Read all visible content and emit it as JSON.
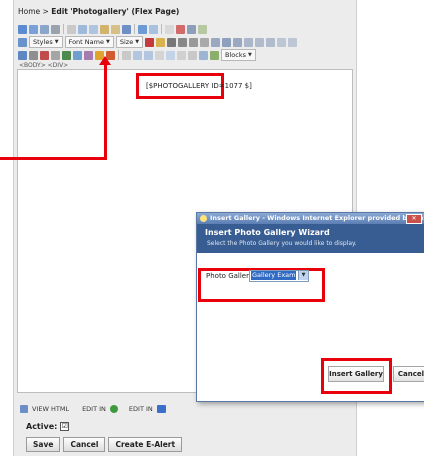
{
  "breadcrumb": {
    "home": "Home",
    "separator": " > ",
    "action": "Edit",
    "page": "'Photogallery' (Flex Page)"
  },
  "toolbar": {
    "styles_label": "Styles",
    "font_name_label": "Font Name",
    "size_label": "Size",
    "blocks_label": "Blocks",
    "row1_icons": [
      "source-icon",
      "preview-icon",
      "templates-icon",
      "print-icon",
      "spellcheck-icon",
      "cut-icon",
      "copy-icon",
      "paste-icon",
      "paste-text-icon",
      "paste-word-icon",
      "undo-icon",
      "redo-icon",
      "find-icon",
      "replace-icon",
      "select-all-icon"
    ],
    "row3_icons": [
      "image-icon",
      "flash-icon",
      "table-icon",
      "horizontal-rule-icon",
      "smiley-icon",
      "special-char-icon",
      "page-break-icon",
      "photogallery-icon",
      "media-icon",
      "form-icon",
      "checkbox-icon",
      "radio-icon",
      "textfield-icon",
      "textarea-icon",
      "select-icon",
      "button-icon",
      "imagebutton-icon",
      "hiddenfield-icon"
    ]
  },
  "tag_path": "<BODY> <DIV>",
  "code_snippet": "[$PHOTOGALLERY ID=1077 $]",
  "footer": {
    "view_html": "VIEW HTML",
    "edit_in_1": "EDIT IN",
    "edit_in_2": "EDIT IN",
    "active_label": "Active:",
    "active_check": "☑",
    "save": "Save",
    "cancel": "Cancel",
    "create_alert": "Create E-Alert"
  },
  "dialog": {
    "window_title": "Insert Gallery - Windows Internet Explorer provided by Dexton ISD Techno...",
    "close": "✕",
    "header_title": "Insert Photo Gallery Wizard",
    "header_subtitle": "Select the Photo Gallery you would like to display.",
    "gallery_label": "Photo Gallery:",
    "gallery_value": "Gallery Example",
    "insert_button": "Insert Gallery",
    "cancel_button": "Cancel"
  },
  "colors": {
    "callout_red": "#e8000b",
    "dialog_header": "#385d92",
    "selection_blue": "#316ac5"
  }
}
